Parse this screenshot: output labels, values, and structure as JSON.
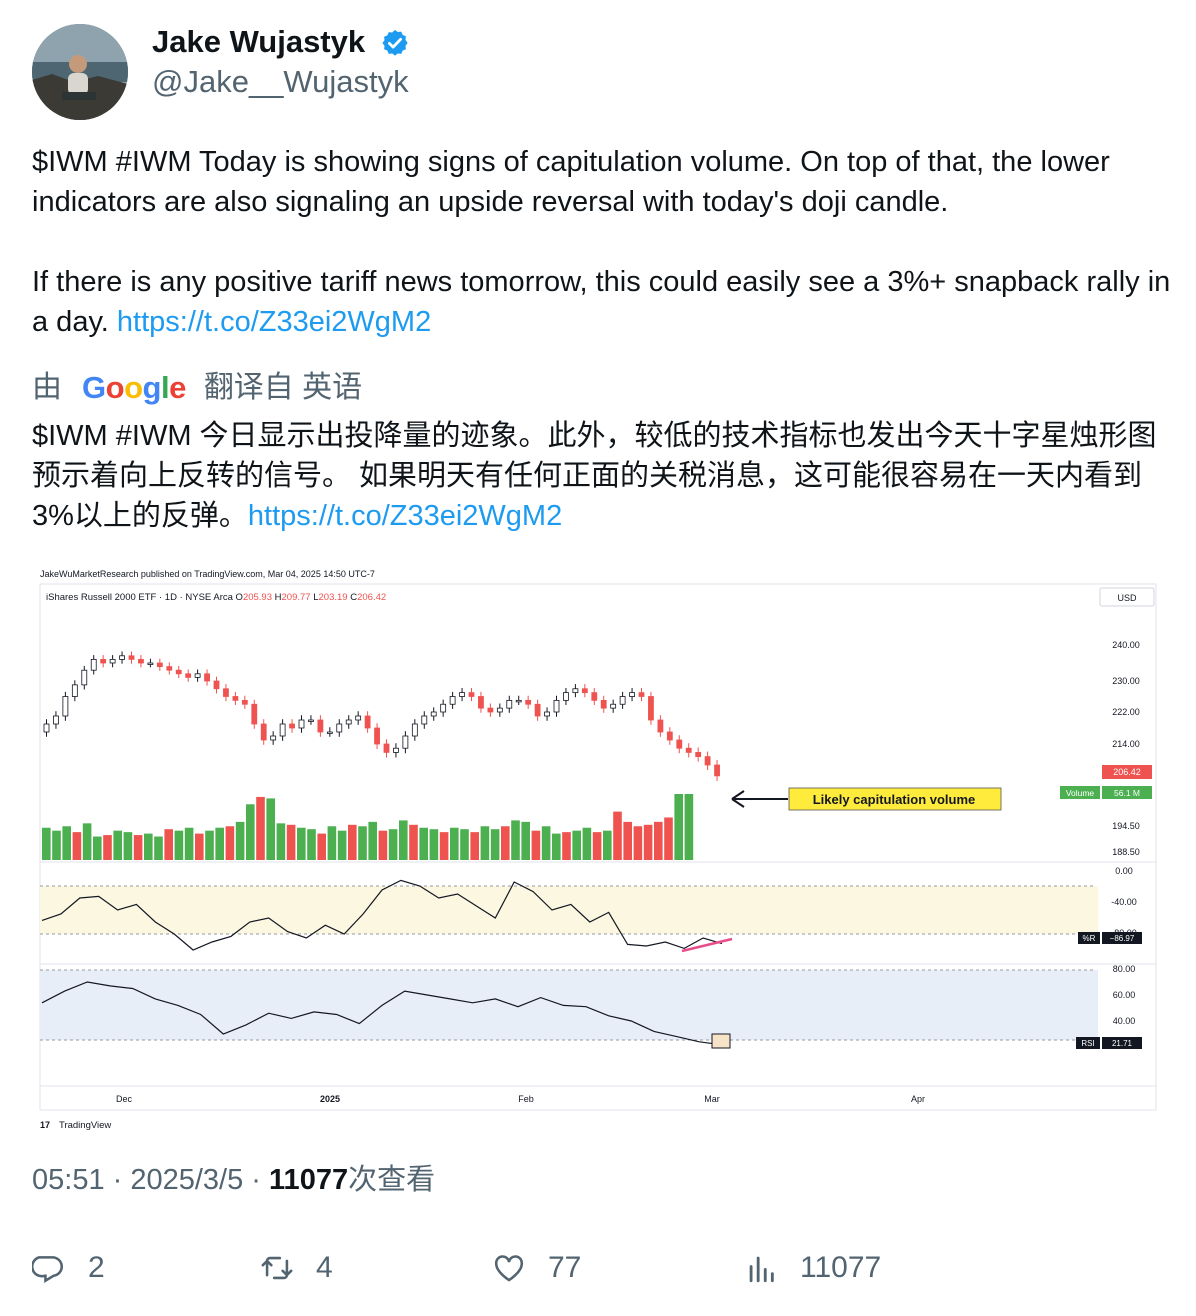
{
  "author": {
    "name": "Jake Wujastyk",
    "handle": "@Jake__Wujastyk",
    "verified": true,
    "verified_color": "#1d9bf0"
  },
  "tweet": {
    "para1": "$IWM #IWM Today is showing signs of capitulation volume. On top of that, the lower indicators are also signaling an upside reversal with today's doji candle.",
    "para2": "If there is any positive tariff news tomorrow, this could easily see a 3%+ snapback rally in a day.",
    "link": "https://t.co/Z33ei2WgM2"
  },
  "translation": {
    "prefix": "由",
    "provider": "Google",
    "suffix": "翻译自 英语",
    "text": "$IWM #IWM 今日显示出投降量的迹象。此外，较低的技术指标也发出今天十字星烛形图预示着向上反转的信号。 如果明天有任何正面的关税消息，这可能很容易在一天内看到3%以上的反弹。",
    "link": "https://t.co/Z33ei2WgM2"
  },
  "chart": {
    "published": "JakeWuMarketResearch published on TradingView.com, Mar 04, 2025 14:50 UTC-7",
    "symbol": "iShares Russell 2000 ETF · 1D · NYSE Arca",
    "ohlc": [
      {
        "k": "O",
        "v": "205.93"
      },
      {
        "k": "H",
        "v": "209.77"
      },
      {
        "k": "L",
        "v": "203.19"
      },
      {
        "k": "C",
        "v": "206.42"
      }
    ],
    "currency": "USD",
    "price_ticks": [
      "240.00",
      "230.00",
      "222.00",
      "214.00",
      "194.50",
      "188.50"
    ],
    "last_price": "206.42",
    "volume_label": "Volume",
    "volume_value": "56.1 M",
    "annotation": "Likely capitulation volume",
    "wr_ticks": [
      "0.00",
      "-40.00",
      "-80.00"
    ],
    "wr_label": "%R",
    "wr_value": "−86.97",
    "rsi_ticks": [
      "80.00",
      "60.00",
      "40.00"
    ],
    "rsi_label": "RSI",
    "rsi_value": "21.71",
    "time_labels": [
      "Dec",
      "2025",
      "Feb",
      "Mar",
      "Apr"
    ],
    "brand": "TradingView",
    "up_color": "#4caf50",
    "down_color": "#ef5350",
    "annotation_color": "#ffeb3b"
  },
  "chart_data": {
    "type": "candlestick",
    "symbol": "IWM",
    "period": "1D",
    "close": [
      219,
      221,
      226,
      229,
      233,
      236,
      235,
      236,
      237,
      236,
      235,
      235,
      234,
      233,
      232,
      231,
      232,
      230,
      228,
      226,
      225,
      224,
      219,
      215,
      216,
      219,
      218,
      220,
      220,
      217,
      217,
      219,
      220,
      221,
      218,
      214,
      212,
      213,
      216,
      219,
      221,
      222,
      224,
      226,
      227,
      226,
      223,
      222,
      223,
      225,
      225,
      224,
      221,
      222,
      225,
      227,
      228,
      227,
      225,
      223,
      224,
      226,
      227,
      226,
      220,
      217,
      215,
      213,
      212,
      211,
      209,
      206.42
    ],
    "volume": [
      22,
      20,
      23,
      19,
      25,
      16,
      17,
      20,
      19,
      17,
      18,
      16,
      21,
      20,
      22,
      18,
      20,
      22,
      23,
      26,
      38,
      43,
      42,
      25,
      24,
      22,
      21,
      18,
      23,
      20,
      24,
      23,
      26,
      20,
      21,
      27,
      24,
      22,
      21,
      19,
      22,
      21,
      19,
      23,
      21,
      23,
      27,
      26,
      20,
      23,
      18,
      19,
      20,
      22,
      19,
      20,
      33,
      26,
      23,
      24,
      26,
      29,
      45,
      45
    ],
    "williams_r": [
      -58,
      -50,
      -30,
      -28,
      -45,
      -38,
      -60,
      -75,
      -95,
      -85,
      -78,
      -60,
      -55,
      -72,
      -80,
      -64,
      -75,
      -50,
      -20,
      -8,
      -15,
      -30,
      -25,
      -40,
      -55,
      -10,
      -22,
      -45,
      -38,
      -60,
      -48,
      -88,
      -90,
      -85,
      -93,
      -80,
      -86.97
    ],
    "rsi": [
      54,
      63,
      70,
      67,
      65,
      57,
      52,
      45,
      30,
      37,
      46,
      42,
      47,
      45,
      38,
      52,
      63,
      60,
      57,
      54,
      57,
      51,
      58,
      52,
      51,
      44,
      40,
      32,
      28,
      24,
      21.71
    ],
    "ylim_price": [
      185,
      245
    ],
    "x_labels": [
      "Dec",
      "2025",
      "Feb",
      "Mar",
      "Apr"
    ]
  },
  "footer": {
    "time": "05:51",
    "date": "2025/3/5",
    "views": "11077",
    "views_suffix": "次查看"
  },
  "actions": {
    "replies": "2",
    "reposts": "4",
    "likes": "77",
    "views": "11077"
  }
}
